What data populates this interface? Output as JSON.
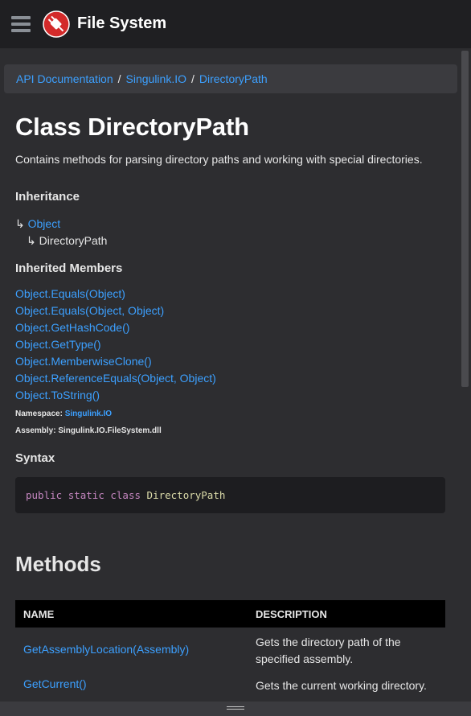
{
  "header": {
    "title": "File System",
    "colors": {
      "bar": "#1f1f22",
      "logo_red": "#d32a2a"
    }
  },
  "breadcrumb": {
    "items": [
      "API Documentation",
      "Singulink.IO",
      "DirectoryPath"
    ],
    "separator": "/"
  },
  "article": {
    "title": "Class DirectoryPath",
    "summary": "Contains methods for parsing directory paths and working with special directories.",
    "inheritance_heading": "Inheritance",
    "inheritance": [
      "Object",
      "DirectoryPath"
    ],
    "inherited_members_heading": "Inherited Members",
    "inherited_members": [
      "Object.Equals(Object)",
      "Object.Equals(Object, Object)",
      "Object.GetHashCode()",
      "Object.GetType()",
      "Object.MemberwiseClone()",
      "Object.ReferenceEquals(Object, Object)",
      "Object.ToString()"
    ],
    "namespace_label": "Namespace:",
    "namespace_value": "Singulink.IO",
    "assembly_label": "Assembly:",
    "assembly_value": "Singulink.IO.FileSystem.dll",
    "syntax_heading": "Syntax",
    "syntax": {
      "kw1": "public",
      "kw2": "static",
      "kw3": "class",
      "name": "DirectoryPath"
    },
    "methods_heading": "Methods",
    "methods_table": {
      "headers": [
        "NAME",
        "DESCRIPTION"
      ],
      "rows": [
        {
          "name": "GetAssemblyLocation(Assembly)",
          "description": "Gets the directory path of the specified assembly."
        },
        {
          "name": "GetCurrent()",
          "description": "Gets the current working directory."
        }
      ]
    }
  },
  "icons": {
    "menu": "hamburger-icon",
    "logo": "plug-logo-icon",
    "inheritance_arrow": "↳"
  }
}
